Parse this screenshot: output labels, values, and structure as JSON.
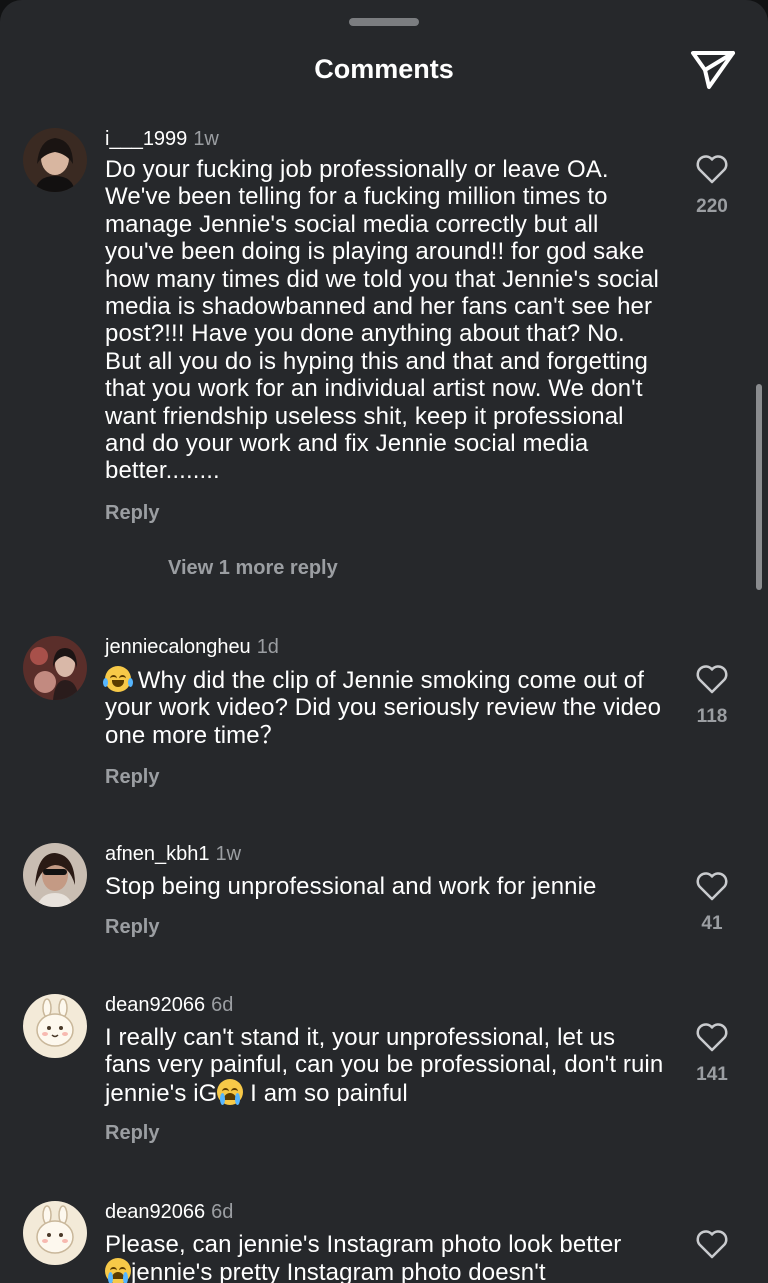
{
  "header": {
    "title": "Comments"
  },
  "comments": [
    {
      "username": "i___1999",
      "time": "1w",
      "text": "Do your fucking job professionally or leave OA. We've been telling for a fucking million times to manage Jennie's social media correctly but all you've been doing is playing around!! for god sake how many times did we told you that Jennie's social media is shadowbanned and her fans can't see her post?!!! Have you done anything about that? No. But all you do is hyping this and that and forgetting that you work for an individual artist now. We don't want friendship useless shit, keep it professional and do your work and fix Jennie social media better........",
      "reply": "Reply",
      "likes": "220",
      "view_more": "View 1 more reply"
    },
    {
      "username": "jenniecalongheu",
      "time": "1d",
      "text": "Why did the clip of Jennie smoking come out of your work video? Did you seriously review the video one more time？",
      "reply": "Reply",
      "likes": "118"
    },
    {
      "username": "afnen_kbh1",
      "time": "1w",
      "text": "Stop being unprofessional and work for jennie",
      "reply": "Reply",
      "likes": "41"
    },
    {
      "username": "dean92066",
      "time": "6d",
      "text_before": "I really can't stand it, your unprofessional, let us fans very painful, can you be professional, don't ruin jennie's iG",
      "text_after": " I am so painful",
      "reply": "Reply",
      "likes": "141"
    },
    {
      "username": "dean92066",
      "time": "6d",
      "text_line1": "Please, can jennie's Instagram photo look better",
      "text_line2": "jennie's pretty Instagram photo doesn't"
    }
  ],
  "icons": {
    "share": "paper-plane-icon",
    "like": "heart-outline-icon",
    "laugh_emoji": "laughing-tears-emoji",
    "cry_emoji": "loudly-crying-emoji"
  },
  "colors": {
    "background": "#26282b",
    "text": "#ffffff",
    "secondary_text": "#9b9ea2"
  }
}
